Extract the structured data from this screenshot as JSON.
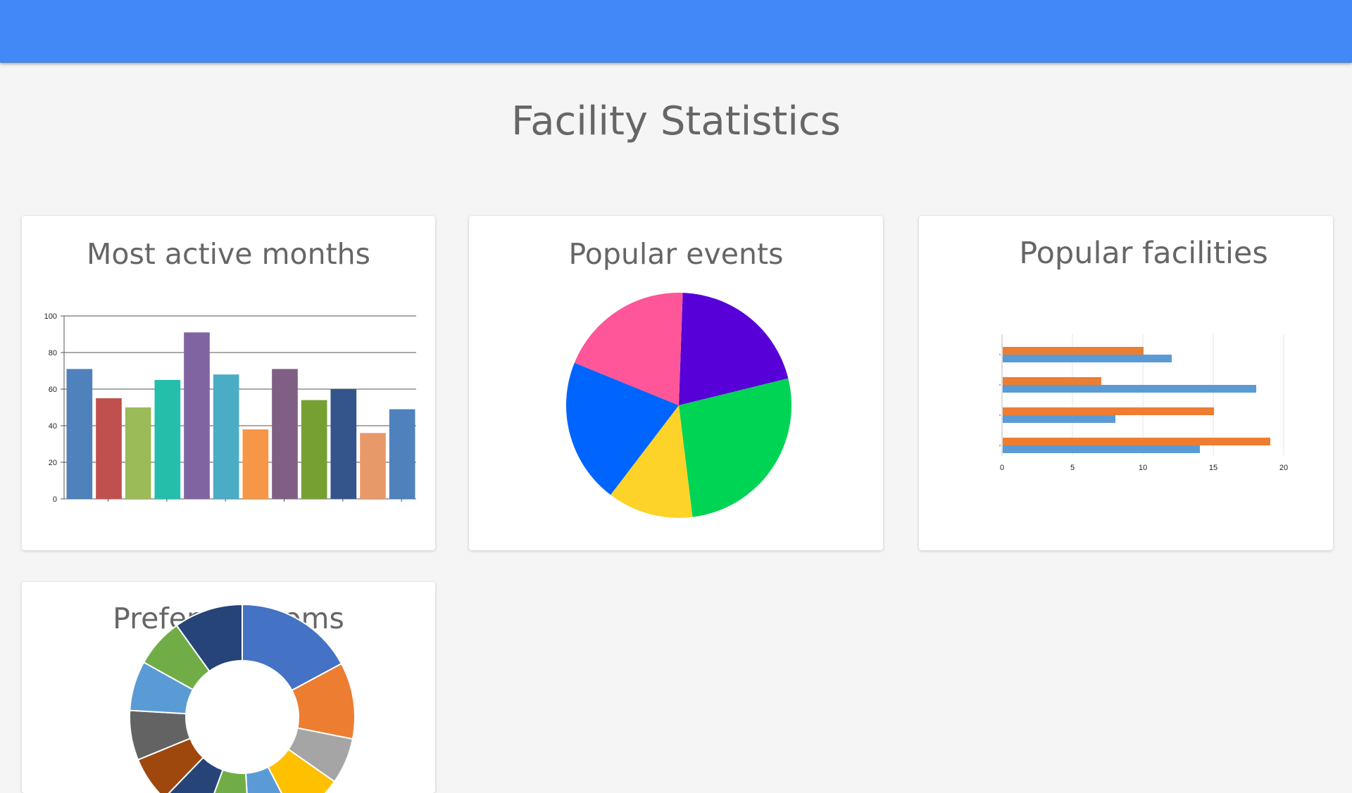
{
  "page": {
    "title": "Facility Statistics",
    "colors": {
      "topbar": "#4289f7",
      "background": "#f5f5f5",
      "card": "#ffffff",
      "text": "#666666"
    }
  },
  "cards": {
    "months": {
      "title": "Most active months"
    },
    "events": {
      "title": "Popular events"
    },
    "facilities": {
      "title": "Popular facilities"
    },
    "rooms": {
      "title": "Preferred rooms"
    }
  },
  "chart_data": [
    {
      "id": "months",
      "type": "bar",
      "values": [
        71,
        55,
        50,
        65,
        91,
        68,
        38,
        71,
        54,
        60,
        36,
        49
      ],
      "colors": [
        "#4f81bd",
        "#c0504d",
        "#9bbb59",
        "#23bfaa",
        "#8064a2",
        "#4bacc6",
        "#f79646",
        "#7f6084",
        "#77a033",
        "#33558b",
        "#e8996a",
        "#4f81bd"
      ],
      "ylim": [
        0,
        100
      ],
      "yticks": [
        0,
        20,
        40,
        60,
        80,
        100
      ],
      "grid": true
    },
    {
      "id": "events",
      "type": "pie",
      "values": [
        20.6,
        26.9,
        12.3,
        20.8,
        19.4
      ],
      "colors": [
        "#5700d8",
        "#00d455",
        "#fdd32a",
        "#0064ff",
        "#ff5599"
      ]
    },
    {
      "id": "facilities",
      "type": "bar",
      "orientation": "horizontal",
      "series": [
        {
          "values": [
            10,
            7,
            15,
            19
          ],
          "color": "#ed7d31"
        },
        {
          "values": [
            12,
            18,
            8,
            14
          ],
          "color": "#5b9bd5"
        }
      ],
      "xlim": [
        0,
        20
      ],
      "xticks": [
        0,
        5,
        10,
        15,
        20
      ],
      "grid": true
    },
    {
      "id": "rooms",
      "type": "pie",
      "donut": true,
      "values": [
        15.6,
        10.0,
        6.0,
        7.0,
        6.0,
        6.0,
        6.0,
        6.0,
        6.5,
        6.5,
        6.4,
        9.0
      ],
      "colors": [
        "#4472c4",
        "#ed7d31",
        "#a5a5a5",
        "#ffc000",
        "#5b9bd5",
        "#70ad47",
        "#264478",
        "#9e480e",
        "#636363",
        "#5b9bd5",
        "#70ad47",
        "#264478"
      ]
    }
  ]
}
